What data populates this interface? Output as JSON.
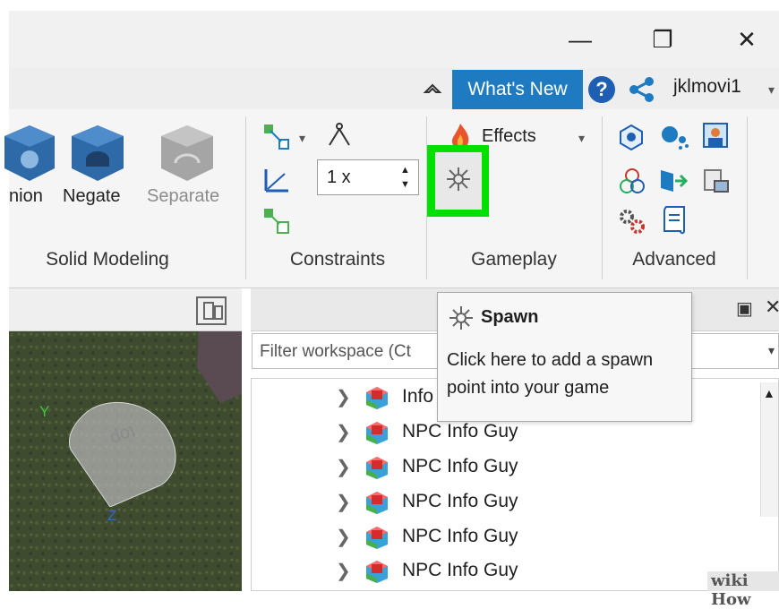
{
  "window": {
    "controls": [
      "—",
      "❐",
      "✕"
    ]
  },
  "menu": {
    "whats_new": "What's New",
    "user": "jklmovi1"
  },
  "ribbon": {
    "solid_modeling": {
      "label": "Solid Modeling",
      "tools": [
        "nion",
        "Negate",
        "Separate"
      ]
    },
    "constraints": {
      "label": "Constraints",
      "scale_value": "1 x"
    },
    "gameplay": {
      "label": "Gameplay",
      "effects": "Effects"
    },
    "advanced": {
      "label": "Advanced"
    }
  },
  "viewport": {
    "part_text": "top",
    "axis_y": "Y",
    "axis_z": "Z"
  },
  "explorer": {
    "filter_placeholder": "Filter workspace (Ct",
    "items": [
      "Info",
      "NPC Info Guy",
      "NPC Info Guy",
      "NPC Info Guy",
      "NPC Info Guy",
      "NPC Info Guy"
    ]
  },
  "tooltip": {
    "title": "Spawn",
    "line1": "Click here to add a spawn",
    "line2": "point into your game"
  },
  "watermark": {
    "text": "wiki How"
  },
  "colors": {
    "accent": "#1e7bc2",
    "highlight": "#00e000",
    "terrain": "#3d4a2e"
  }
}
